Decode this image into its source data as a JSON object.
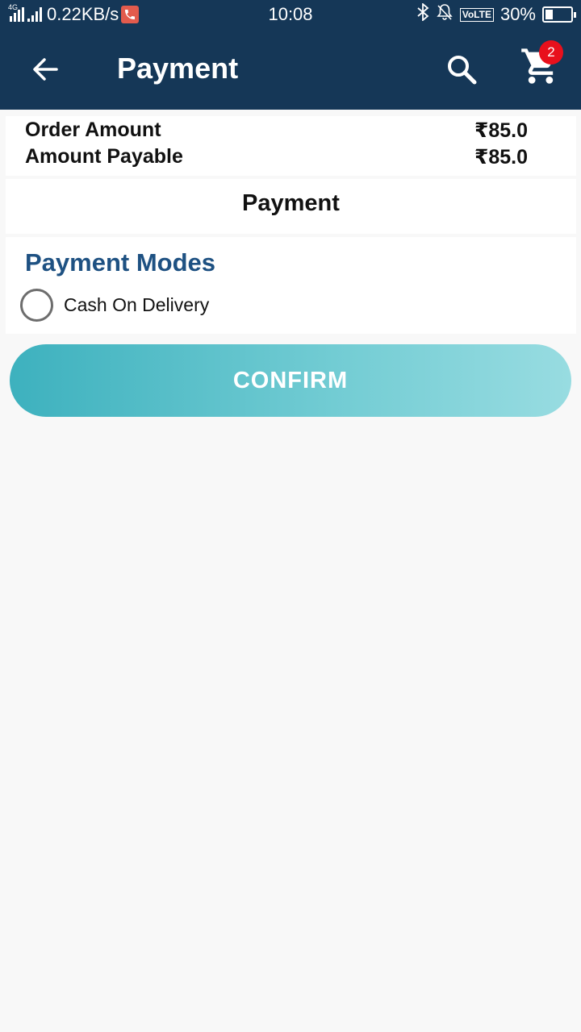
{
  "status_bar": {
    "network": "4G",
    "speed": "0.22KB/s",
    "time": "10:08",
    "volte": "VoLTE",
    "battery": "30%",
    "battery_level": 0.3
  },
  "header": {
    "title": "Payment",
    "cart_count": "2",
    "background": "#153757"
  },
  "amounts": [
    {
      "label": "Order Amount",
      "value": "₹85.0"
    },
    {
      "label": "Amount Payable",
      "value": "₹85.0"
    }
  ],
  "payment_section": {
    "heading": "Payment"
  },
  "payment_modes": {
    "title": "Payment Modes",
    "options": [
      {
        "label": "Cash On Delivery",
        "selected": false
      }
    ]
  },
  "confirm_button": {
    "label": "CONFIRM"
  },
  "colors": {
    "accent": "#1e5182",
    "button_start": "#3db1be",
    "button_end": "#98dce1",
    "badge": "#e8101c"
  },
  "icons": [
    "back-arrow-icon",
    "search-icon",
    "cart-icon",
    "bluetooth-icon",
    "mute-bell-icon",
    "signal-icon",
    "battery-icon",
    "call-icon"
  ]
}
